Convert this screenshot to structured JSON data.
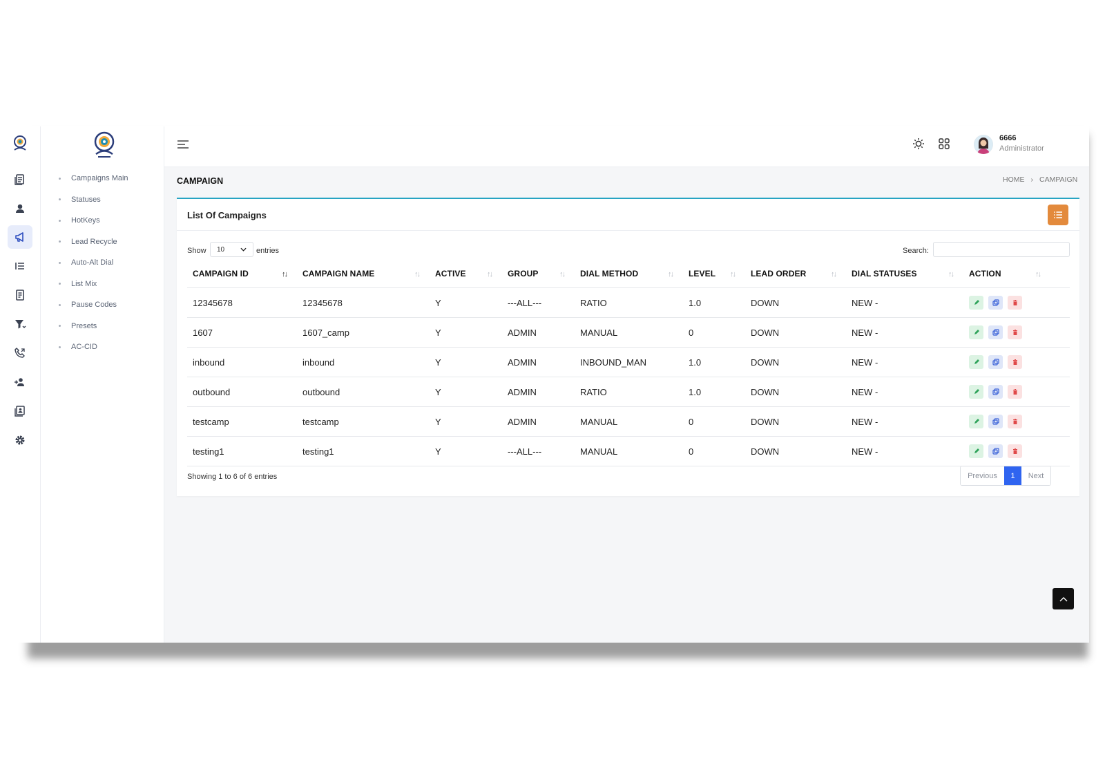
{
  "sidebar": {
    "items": [
      {
        "label": "Campaigns Main"
      },
      {
        "label": "Statuses"
      },
      {
        "label": "HotKeys"
      },
      {
        "label": "Lead Recycle"
      },
      {
        "label": "Auto-Alt Dial"
      },
      {
        "label": "List Mix"
      },
      {
        "label": "Pause Codes"
      },
      {
        "label": "Presets"
      },
      {
        "label": "AC-CID"
      }
    ]
  },
  "header": {
    "user_name": "6666",
    "user_role": "Administrator"
  },
  "page": {
    "title": "CAMPAIGN",
    "breadcrumb": [
      "HOME",
      "CAMPAIGN"
    ]
  },
  "card": {
    "title": "List Of Campaigns",
    "show_label": "Show",
    "entries_value": "10",
    "entries_label": "entries",
    "search_label": "Search:",
    "search_value": ""
  },
  "table": {
    "columns": [
      "CAMPAIGN ID",
      "CAMPAIGN NAME",
      "ACTIVE",
      "GROUP",
      "DIAL METHOD",
      "LEVEL",
      "LEAD ORDER",
      "DIAL STATUSES",
      "ACTION"
    ],
    "rows": [
      [
        "12345678",
        "12345678",
        "Y",
        "---ALL---",
        "RATIO",
        "1.0",
        "DOWN",
        "NEW -"
      ],
      [
        "1607",
        "1607_camp",
        "Y",
        "ADMIN",
        "MANUAL",
        "0",
        "DOWN",
        "NEW -"
      ],
      [
        "inbound",
        "inbound",
        "Y",
        "ADMIN",
        "INBOUND_MAN",
        "1.0",
        "DOWN",
        "NEW -"
      ],
      [
        "outbound",
        "outbound",
        "Y",
        "ADMIN",
        "RATIO",
        "1.0",
        "DOWN",
        "NEW -"
      ],
      [
        "testcamp",
        "testcamp",
        "Y",
        "ADMIN",
        "MANUAL",
        "0",
        "DOWN",
        "NEW -"
      ],
      [
        "testing1",
        "testing1",
        "Y",
        "---ALL---",
        "MANUAL",
        "0",
        "DOWN",
        "NEW -"
      ]
    ]
  },
  "footer": {
    "info": "Showing 1 to 6 of 6 entries",
    "previous": "Previous",
    "page": "1",
    "next": "Next"
  },
  "colors": {
    "accent": "#27a4c3",
    "primary": "#2f64f0",
    "orange": "#e38a3c",
    "edit": "#2fa35a",
    "copy": "#3a62d8",
    "delete": "#e04848"
  }
}
